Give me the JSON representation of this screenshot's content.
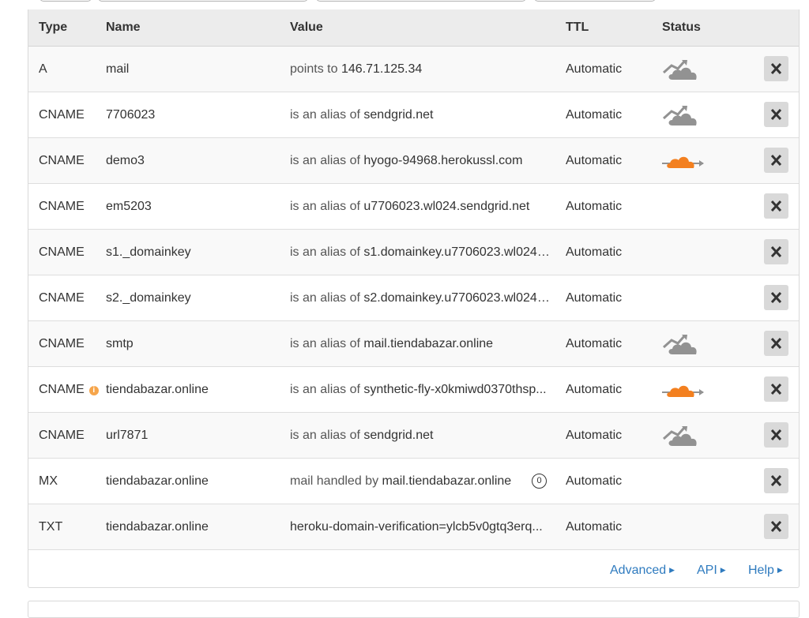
{
  "table": {
    "headers": {
      "type": "Type",
      "name": "Name",
      "value": "Value",
      "ttl": "TTL",
      "status": "Status"
    },
    "rows": [
      {
        "type": "A",
        "name": "mail",
        "prefix": "points to",
        "target": "146.71.125.34",
        "ttl": "Automatic",
        "status": "dns-only-icon"
      },
      {
        "type": "CNAME",
        "name": "7706023",
        "prefix": "is an alias of",
        "target": "sendgrid.net",
        "ttl": "Automatic",
        "status": "dns-only-icon"
      },
      {
        "type": "CNAME",
        "name": "demo3",
        "prefix": "is an alias of",
        "target": "hyogo-94968.herokussl.com",
        "ttl": "Automatic",
        "status": "proxied-icon"
      },
      {
        "type": "CNAME",
        "name": "em5203",
        "prefix": "is an alias of",
        "target": "u7706023.wl024.sendgrid.net",
        "ttl": "Automatic",
        "status": ""
      },
      {
        "type": "CNAME",
        "name": "s1._domainkey",
        "prefix": "is an alias of",
        "target": "s1.domainkey.u7706023.wl024.s...",
        "ttl": "Automatic",
        "status": ""
      },
      {
        "type": "CNAME",
        "name": "s2._domainkey",
        "prefix": "is an alias of",
        "target": "s2.domainkey.u7706023.wl024....",
        "ttl": "Automatic",
        "status": ""
      },
      {
        "type": "CNAME",
        "name": "smtp",
        "prefix": "is an alias of",
        "target": "mail.tiendabazar.online",
        "ttl": "Automatic",
        "status": "dns-only-icon"
      },
      {
        "type": "CNAME",
        "name": "tiendabazar.online",
        "prefix": "is an alias of",
        "target": "synthetic-fly-x0kmiwd0370thsp...",
        "ttl": "Automatic",
        "status": "proxied-icon",
        "info": "i"
      },
      {
        "type": "CNAME",
        "name": "url7871",
        "prefix": "is an alias of",
        "target": "sendgrid.net",
        "ttl": "Automatic",
        "status": "dns-only-icon"
      },
      {
        "type": "MX",
        "name": "tiendabazar.online",
        "prefix": "mail handled by",
        "target": "mail.tiendabazar.online",
        "ttl": "Automatic",
        "status": "",
        "priority": "0"
      },
      {
        "type": "TXT",
        "name": "tiendabazar.online",
        "prefix": "",
        "target": "heroku-domain-verification=ylcb5v0gtq3erq...",
        "ttl": "Automatic",
        "status": ""
      }
    ]
  },
  "footer": {
    "advanced": "Advanced",
    "api": "API",
    "help": "Help"
  },
  "colors": {
    "proxied": "#f38020",
    "dns_only": "#929292",
    "link": "#2f7bbf"
  }
}
